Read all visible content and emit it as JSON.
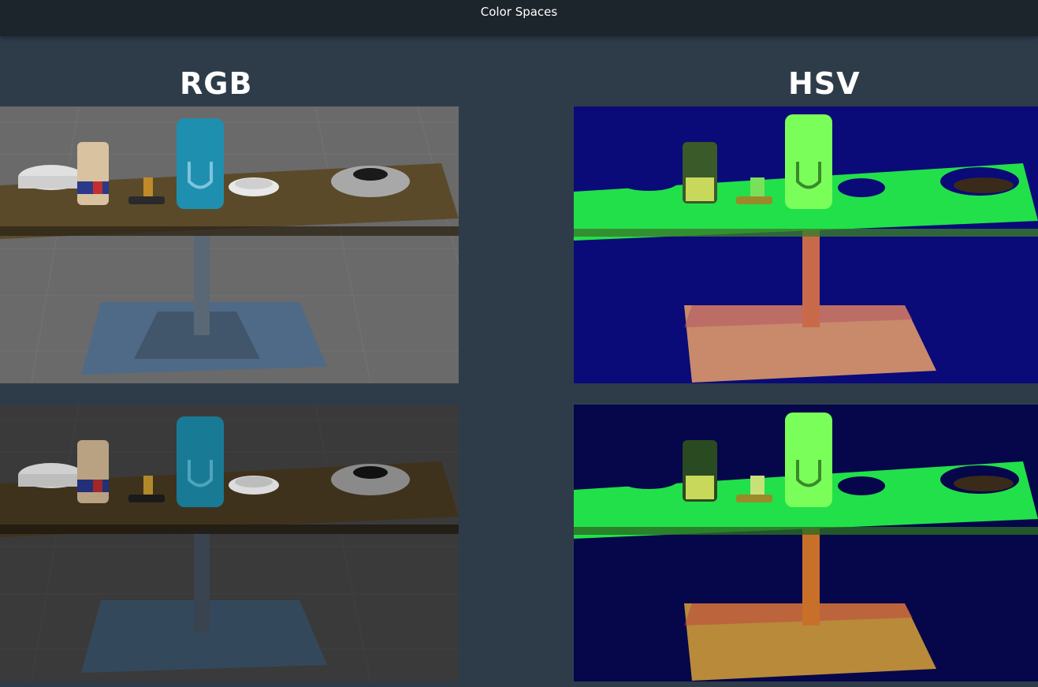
{
  "window": {
    "title": "Color Spaces"
  },
  "columns": {
    "left_heading": "RGB",
    "right_heading": "HSV"
  },
  "colors": {
    "page_bg": "#2e3c4a",
    "topbar_bg": "#1c242c",
    "rgb_table": "#5b4a2a",
    "hsv_background": "#0a0a78",
    "hsv_dark_background": "#06064a",
    "hsv_green": "#22e04a",
    "can_blue": "#1f8fb0"
  },
  "panels": [
    {
      "id": "rgb-normal",
      "kind": "rgb"
    },
    {
      "id": "hsv-normal",
      "kind": "hsv"
    },
    {
      "id": "rgb-dark",
      "kind": "rgb"
    },
    {
      "id": "hsv-dark",
      "kind": "hsv"
    }
  ]
}
